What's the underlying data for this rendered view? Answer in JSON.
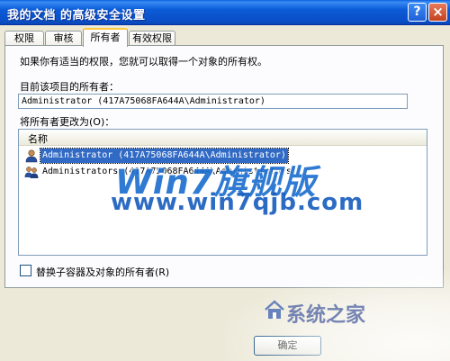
{
  "window": {
    "title": "我的文档 的高级安全设置",
    "help_label": "?",
    "close_label": "×"
  },
  "tabs": [
    {
      "label": "权限"
    },
    {
      "label": "审核"
    },
    {
      "label": "所有者",
      "active": true
    },
    {
      "label": "有效权限"
    }
  ],
  "panel": {
    "intro": "如果你有适当的权限，您就可以取得一个对象的所有权。",
    "current_owner_label": "目前该项目的所有者：",
    "current_owner_value": "Administrator (417A75068FA644A\\Administrator)",
    "change_owner_label": "将所有者更改为(O)：",
    "list": {
      "column_name": "名称",
      "rows": [
        {
          "text": "Administrator (417A75068FA644A\\Administrator)",
          "selected": true,
          "icon": "user-icon"
        },
        {
          "text": "Administrators (417A75068FA644A\\Administrators)",
          "selected": false,
          "icon": "group-icon"
        }
      ]
    },
    "replace_checkbox": {
      "label": "替换子容器及对象的所有者(R)",
      "checked": false
    }
  },
  "footer": {
    "ok_label": "确定"
  },
  "watermark": {
    "line1": "Win7旗舰版",
    "line2": "www.win7qjb.com",
    "line3": "系统之家"
  },
  "colors": {
    "title_bar": "#0A5FDB",
    "selection": "#316AC5",
    "active_tab_accent": "#FFC83C",
    "watermark": "#1E6FD0"
  }
}
